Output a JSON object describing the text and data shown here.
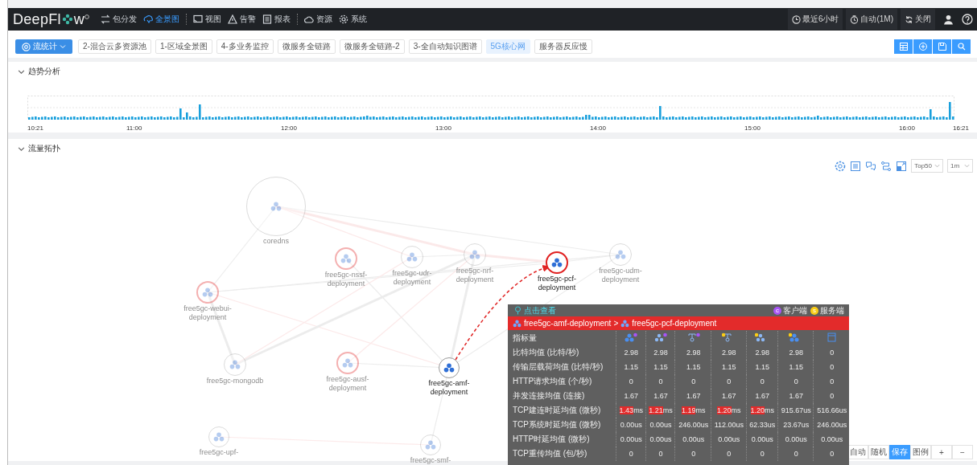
{
  "app": {
    "logo": "DeepFl",
    "logo_tail": "w"
  },
  "nav": [
    {
      "label": "包分发",
      "selected": false
    },
    {
      "label": "全景图",
      "selected": true
    },
    {
      "label": "视图",
      "selected": false
    },
    {
      "label": "告警",
      "selected": false
    },
    {
      "label": "报表",
      "selected": false
    },
    {
      "label": "资源",
      "selected": false
    },
    {
      "label": "系统",
      "selected": false
    }
  ],
  "header_right": [
    {
      "label": "最近6小时"
    },
    {
      "label": "自动(1M)"
    },
    {
      "label": "关闭"
    }
  ],
  "view_menu": {
    "label": "流统计"
  },
  "tabs": [
    {
      "label": "2-混合云多资源池",
      "selected": false
    },
    {
      "label": "1-区域全景图",
      "selected": false
    },
    {
      "label": "4-多业务监控",
      "selected": false
    },
    {
      "label": "微服务全链路",
      "selected": false
    },
    {
      "label": "微服务全链路-2",
      "selected": false
    },
    {
      "label": "3-全自动知识图谱",
      "selected": false
    },
    {
      "label": "5G核心网",
      "selected": true
    },
    {
      "label": "服务器反应慢",
      "selected": false
    }
  ],
  "trend": {
    "title": "趋势分析",
    "expanded": true,
    "time_labels": [
      "10:21",
      "11:00",
      "12:00",
      "13:00",
      "14:00",
      "15:00",
      "16:00",
      "16:21"
    ]
  },
  "topology": {
    "title": "流量拓扑",
    "expanded": true,
    "top_select": "Top50",
    "interval_select": "1m",
    "nodes": [
      {
        "label": "coredns",
        "faded": true,
        "alert": false
      },
      {
        "label": "free5gc-nssf-deployment",
        "faded": true,
        "alert": true
      },
      {
        "label": "free5gc-udr-deployment",
        "faded": true,
        "alert": false
      },
      {
        "label": "free5gc-nrf-deployment",
        "faded": true,
        "alert": false
      },
      {
        "label": "free5gc-pcf-deployment",
        "faded": false,
        "alert": true
      },
      {
        "label": "free5gc-udm-deployment",
        "faded": true,
        "alert": false
      },
      {
        "label": "free5gc-webui-deployment",
        "faded": true,
        "alert": true
      },
      {
        "label": "free5gc-mongodb",
        "faded": true,
        "alert": false
      },
      {
        "label": "free5gc-ausf-deployment",
        "faded": true,
        "alert": true
      },
      {
        "label": "free5gc-amf-deployment",
        "faded": false,
        "alert": false
      },
      {
        "label": "free5gc-upf-",
        "faded": true,
        "alert": false
      },
      {
        "label": "free5gc-smf-",
        "faded": true,
        "alert": false
      }
    ],
    "controls": [
      {
        "label": "自动",
        "selected": false
      },
      {
        "label": "随机",
        "selected": false
      },
      {
        "label": "保存",
        "selected": true
      },
      {
        "label": "图例",
        "selected": false
      },
      {
        "label": "+",
        "selected": false
      },
      {
        "label": "−",
        "selected": false
      }
    ]
  },
  "tooltip": {
    "hint": "点击查看",
    "legend": [
      {
        "letter": "c",
        "label": "客户端",
        "color": "#a855f7"
      },
      {
        "letter": "s",
        "label": "服务端",
        "color": "#facc15"
      }
    ],
    "source": "free5gc-amf-deployment",
    "separator": ">",
    "target": "free5gc-pcf-deployment",
    "metric_header": "指标量",
    "columns": [
      {
        "kind": "pod-client"
      },
      {
        "kind": "podlight-client"
      },
      {
        "kind": "service-client"
      },
      {
        "kind": "service-server"
      },
      {
        "kind": "podlight-server"
      },
      {
        "kind": "pod-server"
      },
      {
        "kind": "host"
      }
    ],
    "rows": [
      {
        "metric": "比特均值 (比特/秒)",
        "cells": [
          "2.98",
          "2.98",
          "2.98",
          "2.98",
          "2.98",
          "2.98",
          "0"
        ]
      },
      {
        "metric": "传输层载荷均值 (比特/秒)",
        "cells": [
          "1.15",
          "1.15",
          "1.15",
          "1.15",
          "1.15",
          "1.15",
          "0"
        ]
      },
      {
        "metric": "HTTP请求均值 (个/秒)",
        "cells": [
          "0",
          "0",
          "0",
          "0",
          "0",
          "0",
          "0"
        ]
      },
      {
        "metric": "并发连接均值 (连接)",
        "cells": [
          "1.67",
          "1.67",
          "1.67",
          "1.67",
          "1.67",
          "1.67",
          "0"
        ]
      },
      {
        "metric": "TCP建连时延均值 (微秒)",
        "cells": [
          {
            "number": "1.43",
            "unit": "ms",
            "alert": true
          },
          {
            "number": "1.21",
            "unit": "ms",
            "alert": true
          },
          {
            "number": "1.19",
            "unit": "ms",
            "alert": true
          },
          {
            "number": "1.20",
            "unit": "ms",
            "alert": true
          },
          {
            "number": "1.20",
            "unit": "ms",
            "alert": true
          },
          {
            "number": "915.67",
            "unit": "us",
            "alert": false
          },
          {
            "number": "516.66",
            "unit": "us",
            "alert": false
          }
        ]
      },
      {
        "metric": "TCP系统时延均值 (微秒)",
        "cells": [
          "0.00us",
          "0.00us",
          "246.00us",
          "112.00us",
          "62.33us",
          "23.67us",
          "246.00us"
        ]
      },
      {
        "metric": "HTTP时延均值 (微秒)",
        "cells": [
          "0.00us",
          "0.00us",
          "0.00us",
          "0.00us",
          "0.00us",
          "0.00us",
          "0.00us"
        ]
      },
      {
        "metric": "TCP重传均值 (包/秒)",
        "cells": [
          "0",
          "0",
          "0",
          "0",
          "0",
          "0",
          "0"
        ]
      }
    ]
  }
}
